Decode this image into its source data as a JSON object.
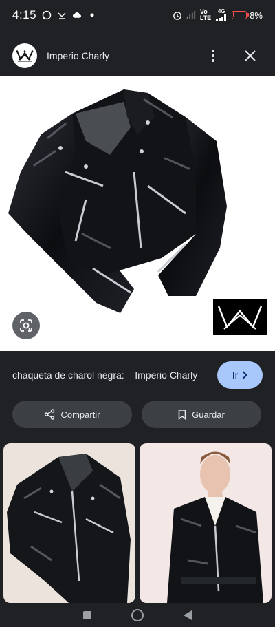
{
  "status_bar": {
    "time": "4:15",
    "network_label_top": "Vo",
    "network_label_bottom": "LTE",
    "network_type": "4G",
    "battery_percent": "8%",
    "battery_level": 0.08,
    "battery_color": "#ff4d4d"
  },
  "header": {
    "site_name": "Imperio Charly"
  },
  "result": {
    "caption": "chaqueta de charol negra: – Imperio Charly",
    "go_label": "Ir"
  },
  "actions": {
    "share_label": "Compartir",
    "save_label": "Guardar"
  },
  "colors": {
    "background": "#202124",
    "accent_button": "#a8c7fa",
    "chip": "#3c4043"
  },
  "icons": {
    "header_more": "more-vert-icon",
    "header_close": "close-icon",
    "lens": "lens-icon",
    "share": "share-icon",
    "save": "bookmark-icon",
    "go": "chevron-right-icon"
  }
}
